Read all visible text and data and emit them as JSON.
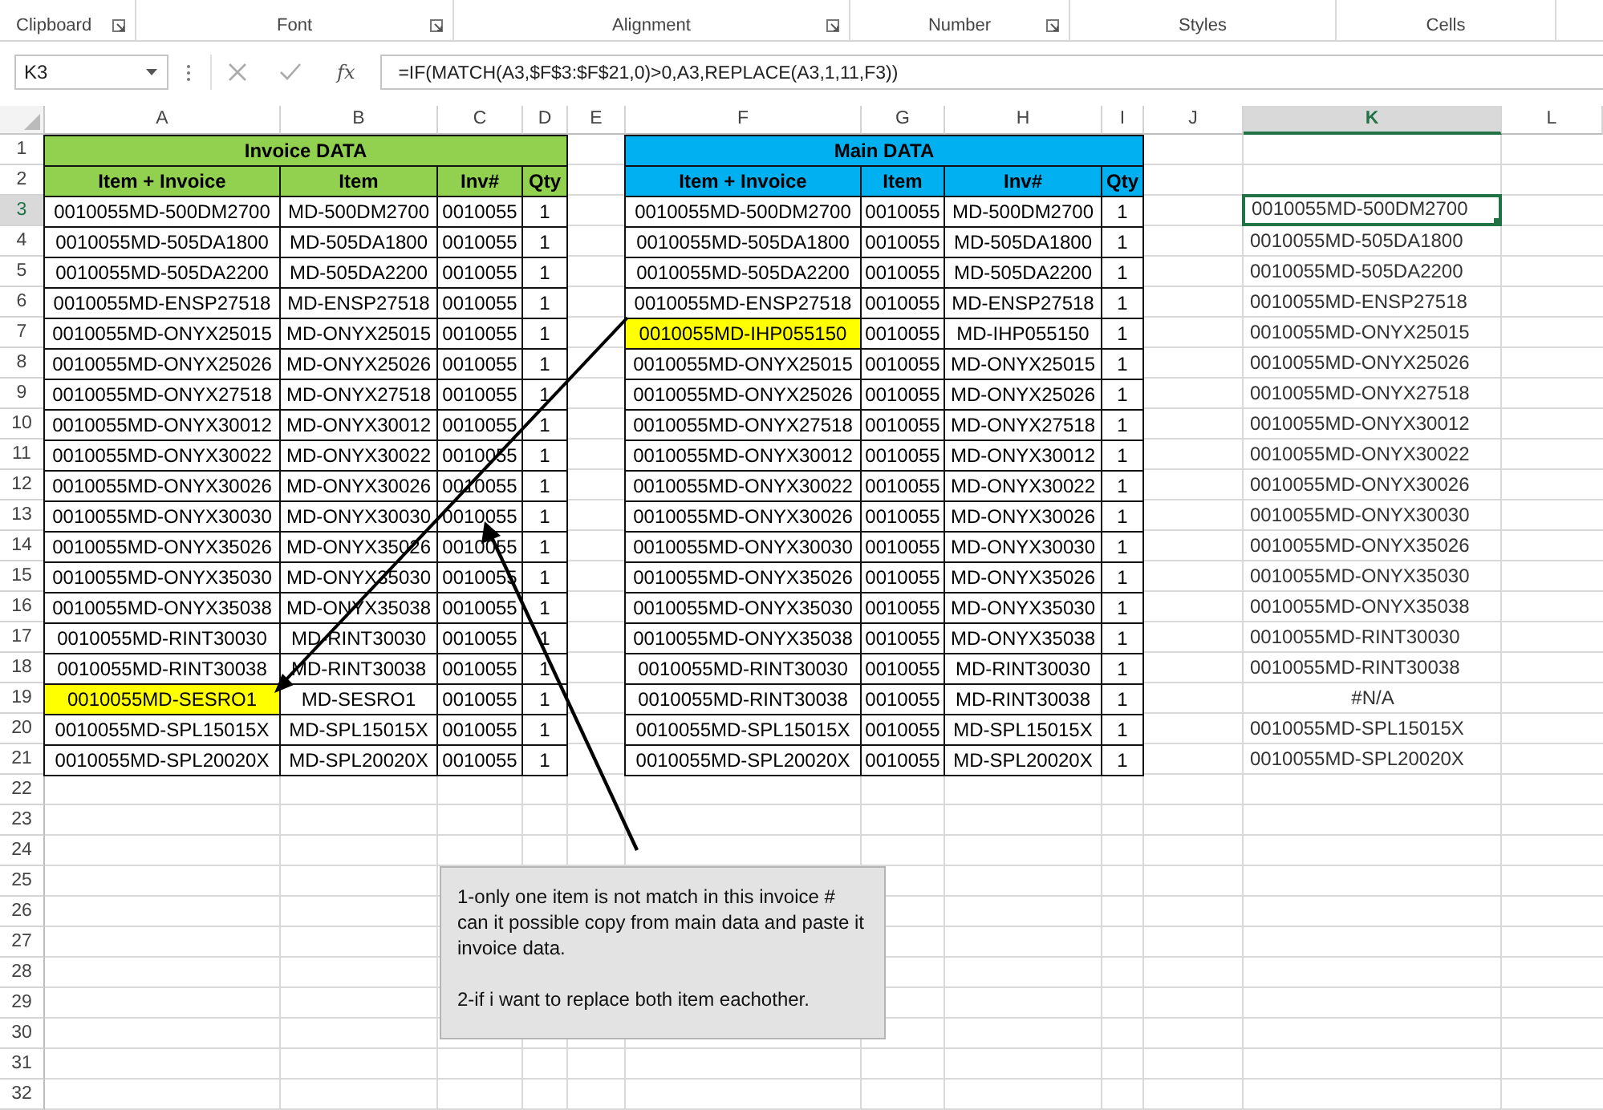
{
  "ribbon": {
    "groups": [
      {
        "label": "Clipboard",
        "launcher": true
      },
      {
        "label": "Font",
        "launcher": true
      },
      {
        "label": "Alignment",
        "launcher": true
      },
      {
        "label": "Number",
        "launcher": true
      },
      {
        "label": "Styles",
        "launcher": false
      },
      {
        "label": "Cells",
        "launcher": false
      }
    ]
  },
  "formula_bar": {
    "name_box": "K3",
    "function_label": "fx",
    "formula": "=IF(MATCH(A3,$F$3:$F$21,0)>0,A3,REPLACE(A3,1,11,F3))"
  },
  "columns": [
    {
      "label": "A",
      "selected": false
    },
    {
      "label": "B",
      "selected": false
    },
    {
      "label": "C",
      "selected": false
    },
    {
      "label": "D",
      "selected": false
    },
    {
      "label": "E",
      "selected": false
    },
    {
      "label": "F",
      "selected": false
    },
    {
      "label": "G",
      "selected": false
    },
    {
      "label": "H",
      "selected": false
    },
    {
      "label": "I",
      "selected": false
    },
    {
      "label": "J",
      "selected": false
    },
    {
      "label": "K",
      "selected": true
    },
    {
      "label": "L",
      "selected": false
    }
  ],
  "rows": [
    {
      "label": "1",
      "selected": false
    },
    {
      "label": "2",
      "selected": false
    },
    {
      "label": "3",
      "selected": true
    },
    {
      "label": "4",
      "selected": false
    },
    {
      "label": "5",
      "selected": false
    },
    {
      "label": "6",
      "selected": false
    },
    {
      "label": "7",
      "selected": false
    },
    {
      "label": "8",
      "selected": false
    },
    {
      "label": "9",
      "selected": false
    },
    {
      "label": "10",
      "selected": false
    },
    {
      "label": "11",
      "selected": false
    },
    {
      "label": "12",
      "selected": false
    },
    {
      "label": "13",
      "selected": false
    },
    {
      "label": "14",
      "selected": false
    },
    {
      "label": "15",
      "selected": false
    },
    {
      "label": "16",
      "selected": false
    },
    {
      "label": "17",
      "selected": false
    },
    {
      "label": "18",
      "selected": false
    },
    {
      "label": "19",
      "selected": false
    },
    {
      "label": "20",
      "selected": false
    },
    {
      "label": "21",
      "selected": false
    },
    {
      "label": "22",
      "selected": false
    },
    {
      "label": "23",
      "selected": false
    },
    {
      "label": "24",
      "selected": false
    },
    {
      "label": "25",
      "selected": false
    },
    {
      "label": "26",
      "selected": false
    },
    {
      "label": "27",
      "selected": false
    },
    {
      "label": "28",
      "selected": false
    },
    {
      "label": "29",
      "selected": false
    },
    {
      "label": "30",
      "selected": false
    },
    {
      "label": "31",
      "selected": false
    },
    {
      "label": "32",
      "selected": false
    }
  ],
  "invoice_table": {
    "title": "Invoice DATA",
    "headers": [
      "Item + Invoice",
      "Item",
      "Inv#",
      "Qty"
    ],
    "rows": [
      {
        "cells": [
          "0010055MD-500DM2700",
          "MD-500DM2700",
          "0010055",
          "1"
        ],
        "highlighted": false
      },
      {
        "cells": [
          "0010055MD-505DA1800",
          "MD-505DA1800",
          "0010055",
          "1"
        ],
        "highlighted": false
      },
      {
        "cells": [
          "0010055MD-505DA2200",
          "MD-505DA2200",
          "0010055",
          "1"
        ],
        "highlighted": false
      },
      {
        "cells": [
          "0010055MD-ENSP27518",
          "MD-ENSP27518",
          "0010055",
          "1"
        ],
        "highlighted": false
      },
      {
        "cells": [
          "0010055MD-ONYX25015",
          "MD-ONYX25015",
          "0010055",
          "1"
        ],
        "highlighted": false
      },
      {
        "cells": [
          "0010055MD-ONYX25026",
          "MD-ONYX25026",
          "0010055",
          "1"
        ],
        "highlighted": false
      },
      {
        "cells": [
          "0010055MD-ONYX27518",
          "MD-ONYX27518",
          "0010055",
          "1"
        ],
        "highlighted": false
      },
      {
        "cells": [
          "0010055MD-ONYX30012",
          "MD-ONYX30012",
          "0010055",
          "1"
        ],
        "highlighted": false
      },
      {
        "cells": [
          "0010055MD-ONYX30022",
          "MD-ONYX30022",
          "0010055",
          "1"
        ],
        "highlighted": false
      },
      {
        "cells": [
          "0010055MD-ONYX30026",
          "MD-ONYX30026",
          "0010055",
          "1"
        ],
        "highlighted": false
      },
      {
        "cells": [
          "0010055MD-ONYX30030",
          "MD-ONYX30030",
          "0010055",
          "1"
        ],
        "highlighted": false
      },
      {
        "cells": [
          "0010055MD-ONYX35026",
          "MD-ONYX35026",
          "0010055",
          "1"
        ],
        "highlighted": false
      },
      {
        "cells": [
          "0010055MD-ONYX35030",
          "MD-ONYX35030",
          "0010055",
          "1"
        ],
        "highlighted": false
      },
      {
        "cells": [
          "0010055MD-ONYX35038",
          "MD-ONYX35038",
          "0010055",
          "1"
        ],
        "highlighted": false
      },
      {
        "cells": [
          "0010055MD-RINT30030",
          "MD-RINT30030",
          "0010055",
          "1"
        ],
        "highlighted": false
      },
      {
        "cells": [
          "0010055MD-RINT30038",
          "MD-RINT30038",
          "0010055",
          "1"
        ],
        "highlighted": false
      },
      {
        "cells": [
          "0010055MD-SESRO1",
          "MD-SESRO1",
          "0010055",
          "1"
        ],
        "highlighted": true
      },
      {
        "cells": [
          "0010055MD-SPL15015X",
          "MD-SPL15015X",
          "0010055",
          "1"
        ],
        "highlighted": false
      },
      {
        "cells": [
          "0010055MD-SPL20020X",
          "MD-SPL20020X",
          "0010055",
          "1"
        ],
        "highlighted": false
      }
    ]
  },
  "main_table": {
    "title": "Main DATA",
    "headers": [
      "Item + Invoice",
      "Item",
      "Inv#",
      "Qty"
    ],
    "rows": [
      {
        "cells": [
          "0010055MD-500DM2700",
          "0010055",
          "MD-500DM2700",
          "1"
        ],
        "highlighted": false
      },
      {
        "cells": [
          "0010055MD-505DA1800",
          "0010055",
          "MD-505DA1800",
          "1"
        ],
        "highlighted": false
      },
      {
        "cells": [
          "0010055MD-505DA2200",
          "0010055",
          "MD-505DA2200",
          "1"
        ],
        "highlighted": false
      },
      {
        "cells": [
          "0010055MD-ENSP27518",
          "0010055",
          "MD-ENSP27518",
          "1"
        ],
        "highlighted": false
      },
      {
        "cells": [
          "0010055MD-IHP055150",
          "0010055",
          "MD-IHP055150",
          "1"
        ],
        "highlighted": true
      },
      {
        "cells": [
          "0010055MD-ONYX25015",
          "0010055",
          "MD-ONYX25015",
          "1"
        ],
        "highlighted": false
      },
      {
        "cells": [
          "0010055MD-ONYX25026",
          "0010055",
          "MD-ONYX25026",
          "1"
        ],
        "highlighted": false
      },
      {
        "cells": [
          "0010055MD-ONYX27518",
          "0010055",
          "MD-ONYX27518",
          "1"
        ],
        "highlighted": false
      },
      {
        "cells": [
          "0010055MD-ONYX30012",
          "0010055",
          "MD-ONYX30012",
          "1"
        ],
        "highlighted": false
      },
      {
        "cells": [
          "0010055MD-ONYX30022",
          "0010055",
          "MD-ONYX30022",
          "1"
        ],
        "highlighted": false
      },
      {
        "cells": [
          "0010055MD-ONYX30026",
          "0010055",
          "MD-ONYX30026",
          "1"
        ],
        "highlighted": false
      },
      {
        "cells": [
          "0010055MD-ONYX30030",
          "0010055",
          "MD-ONYX30030",
          "1"
        ],
        "highlighted": false
      },
      {
        "cells": [
          "0010055MD-ONYX35026",
          "0010055",
          "MD-ONYX35026",
          "1"
        ],
        "highlighted": false
      },
      {
        "cells": [
          "0010055MD-ONYX35030",
          "0010055",
          "MD-ONYX35030",
          "1"
        ],
        "highlighted": false
      },
      {
        "cells": [
          "0010055MD-ONYX35038",
          "0010055",
          "MD-ONYX35038",
          "1"
        ],
        "highlighted": false
      },
      {
        "cells": [
          "0010055MD-RINT30030",
          "0010055",
          "MD-RINT30030",
          "1"
        ],
        "highlighted": false
      },
      {
        "cells": [
          "0010055MD-RINT30038",
          "0010055",
          "MD-RINT30038",
          "1"
        ],
        "highlighted": false
      },
      {
        "cells": [
          "0010055MD-SPL15015X",
          "0010055",
          "MD-SPL15015X",
          "1"
        ],
        "highlighted": false
      },
      {
        "cells": [
          "0010055MD-SPL20020X",
          "0010055",
          "MD-SPL20020X",
          "1"
        ],
        "highlighted": false
      }
    ]
  },
  "column_k": {
    "cells": [
      {
        "text": "0010055MD-500DM2700",
        "kind": "text",
        "selected": true
      },
      {
        "text": "0010055MD-505DA1800",
        "kind": "text",
        "selected": false
      },
      {
        "text": "0010055MD-505DA2200",
        "kind": "text",
        "selected": false
      },
      {
        "text": "0010055MD-ENSP27518",
        "kind": "text",
        "selected": false
      },
      {
        "text": "0010055MD-ONYX25015",
        "kind": "text",
        "selected": false
      },
      {
        "text": "0010055MD-ONYX25026",
        "kind": "text",
        "selected": false
      },
      {
        "text": "0010055MD-ONYX27518",
        "kind": "text",
        "selected": false
      },
      {
        "text": "0010055MD-ONYX30012",
        "kind": "text",
        "selected": false
      },
      {
        "text": "0010055MD-ONYX30022",
        "kind": "text",
        "selected": false
      },
      {
        "text": "0010055MD-ONYX30026",
        "kind": "text",
        "selected": false
      },
      {
        "text": "0010055MD-ONYX30030",
        "kind": "text",
        "selected": false
      },
      {
        "text": "0010055MD-ONYX35026",
        "kind": "text",
        "selected": false
      },
      {
        "text": "0010055MD-ONYX35030",
        "kind": "text",
        "selected": false
      },
      {
        "text": "0010055MD-ONYX35038",
        "kind": "text",
        "selected": false
      },
      {
        "text": "0010055MD-RINT30030",
        "kind": "text",
        "selected": false
      },
      {
        "text": "0010055MD-RINT30038",
        "kind": "text",
        "selected": false
      },
      {
        "text": "#N/A",
        "kind": "error",
        "selected": false
      },
      {
        "text": "0010055MD-SPL15015X",
        "kind": "text",
        "selected": false
      },
      {
        "text": "0010055MD-SPL20020X",
        "kind": "text",
        "selected": false
      }
    ]
  },
  "note": {
    "paragraphs": [
      "1-only one item is not match in this invoice # can it possible copy from main data and paste it invoice data.",
      "2-if i want to replace both item eachother."
    ]
  }
}
